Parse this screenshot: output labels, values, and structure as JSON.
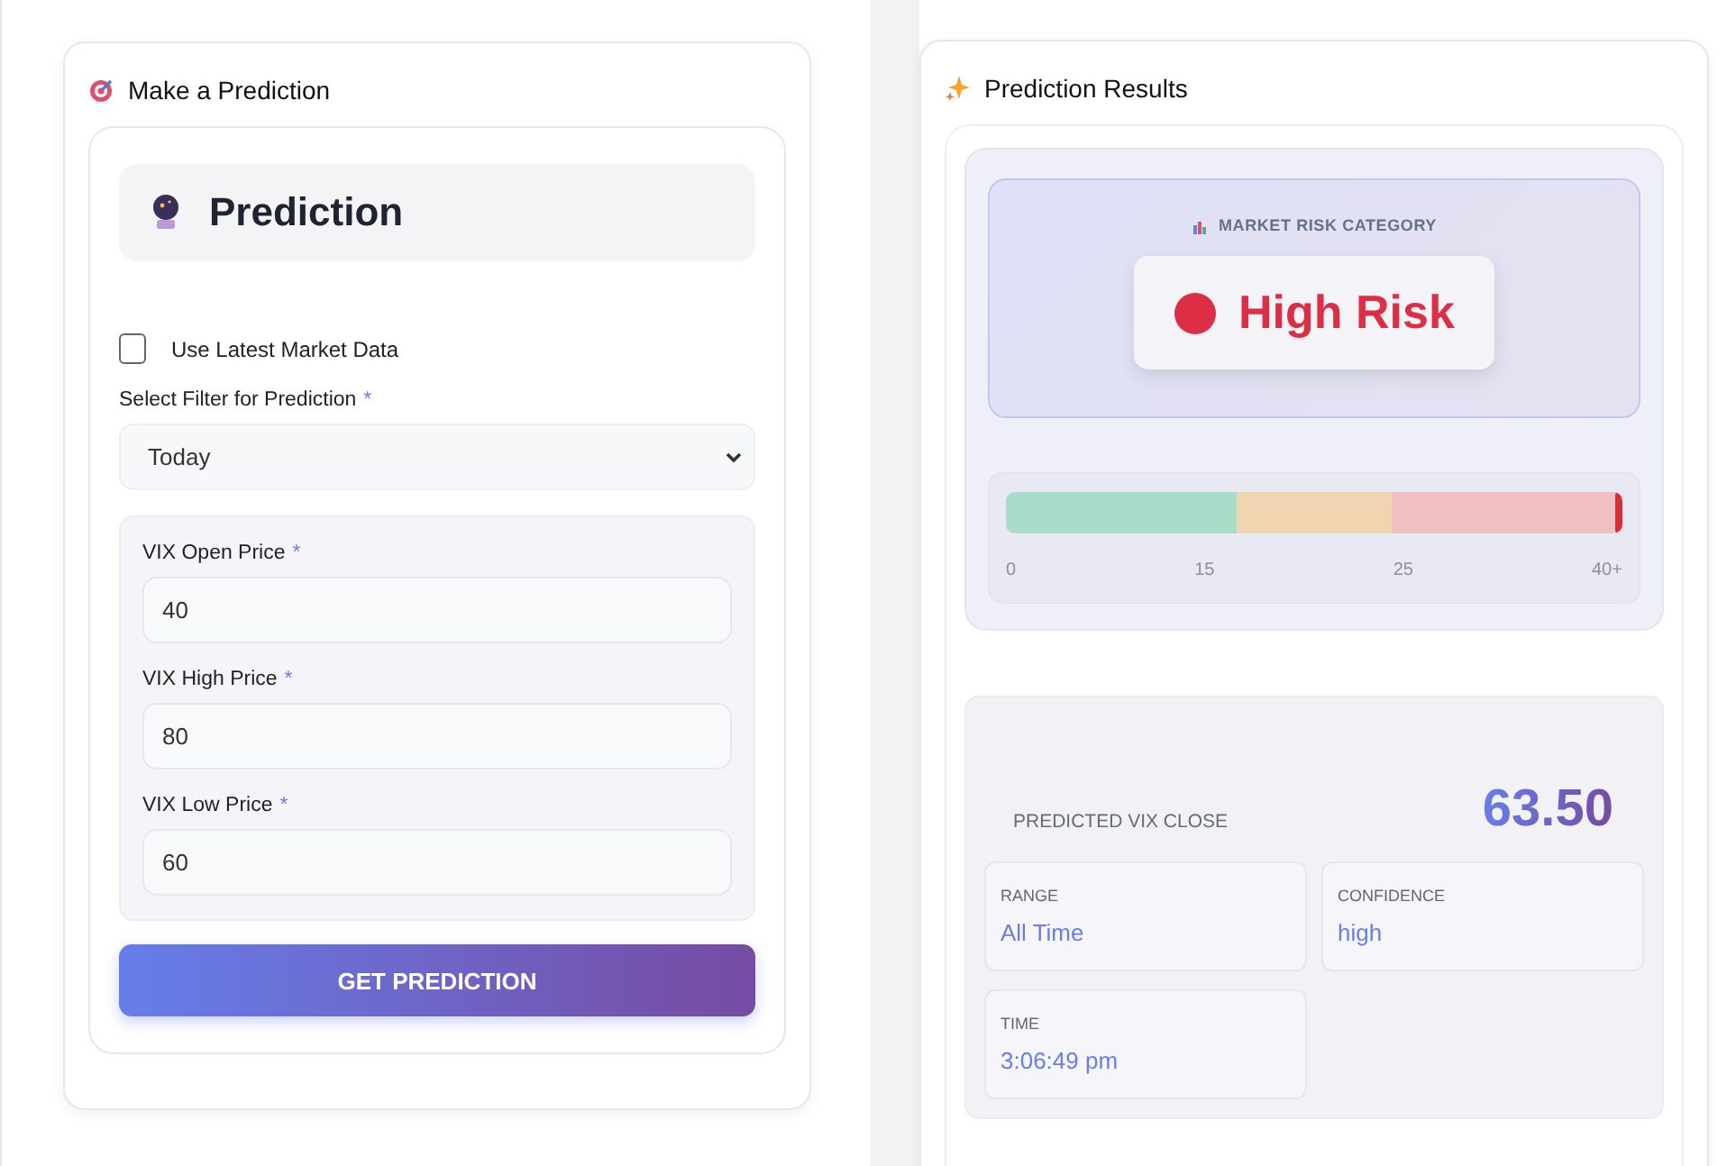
{
  "form_panel": {
    "title": "Make a Prediction",
    "header": "Prediction",
    "use_latest": {
      "label": "Use Latest Market Data",
      "checked": false
    },
    "filter": {
      "label": "Select Filter for Prediction",
      "required_mark": "*",
      "value": "Today"
    },
    "fields": [
      {
        "label": "VIX Open Price",
        "required_mark": "*",
        "value": "40"
      },
      {
        "label": "VIX High Price",
        "required_mark": "*",
        "value": "80"
      },
      {
        "label": "VIX Low Price",
        "required_mark": "*",
        "value": "60"
      }
    ],
    "submit": "GET PREDICTION"
  },
  "results_panel": {
    "title": "Prediction Results",
    "category_label": "MARKET RISK CATEGORY",
    "risk": {
      "label": "High Risk",
      "kind": "high"
    },
    "meter": {
      "level": 1,
      "ticks": [
        "0",
        "15",
        "25",
        "40+"
      ]
    },
    "predicted_label": "PREDICTED VIX CLOSE",
    "predicted_value": "63.50",
    "details": [
      {
        "label": "RANGE",
        "value": "All Time"
      },
      {
        "label": "CONFIDENCE",
        "value": "high"
      },
      {
        "label": "TIME",
        "value": "3:06:49 pm"
      }
    ]
  }
}
